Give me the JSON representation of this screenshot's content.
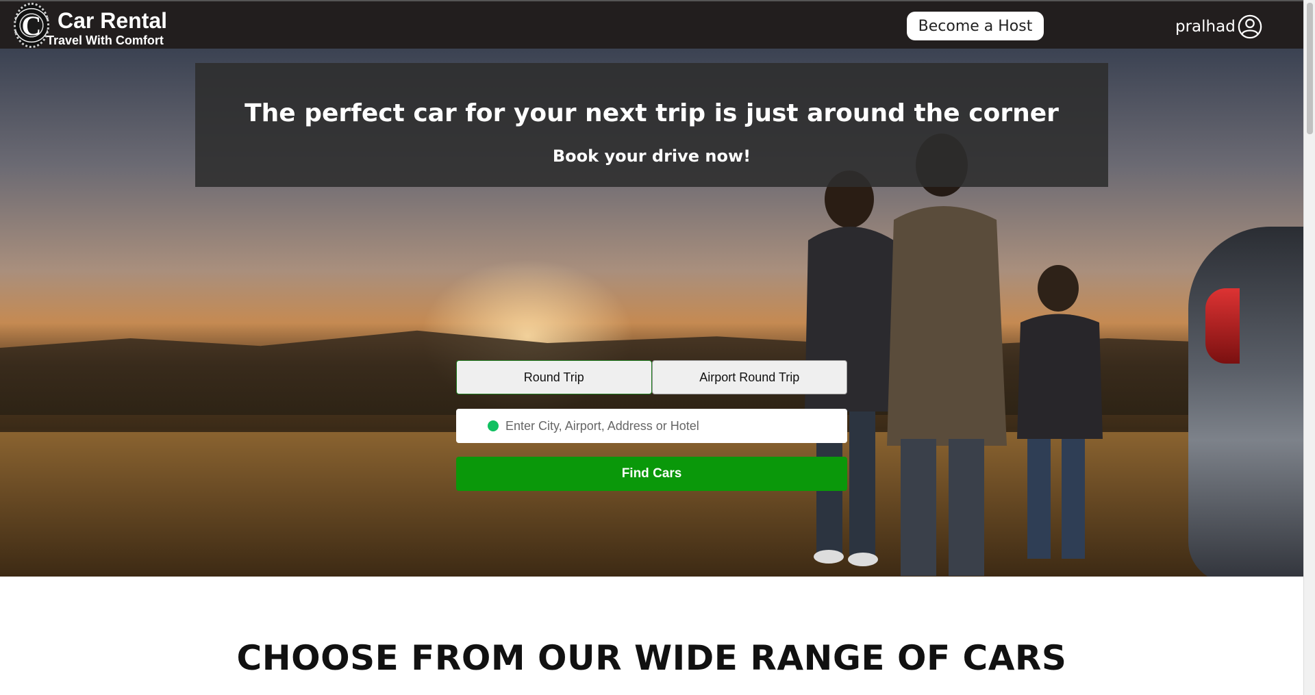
{
  "header": {
    "logo_letter": "C",
    "brand_title": "Car Rental",
    "brand_tagline": "Travel With Comfort",
    "host_button": "Become a Host",
    "username": "pralhad",
    "user_icon": "user-circle-icon"
  },
  "hero": {
    "headline": "The perfect car for your next trip is just around the corner",
    "subheadline": "Book your drive now!",
    "trip_types": [
      "Round Trip",
      "Airport Round Trip"
    ],
    "selected_trip_type": "Round Trip",
    "location_placeholder": "Enter City, Airport, Address or Hotel",
    "location_value": "",
    "find_button": "Find Cars",
    "colors": {
      "find_button": "#0a980a",
      "location_dot": "#10c060",
      "header_bg": "#221e1e"
    }
  },
  "section": {
    "title": "CHOOSE FROM OUR WIDE RANGE OF CARS"
  }
}
